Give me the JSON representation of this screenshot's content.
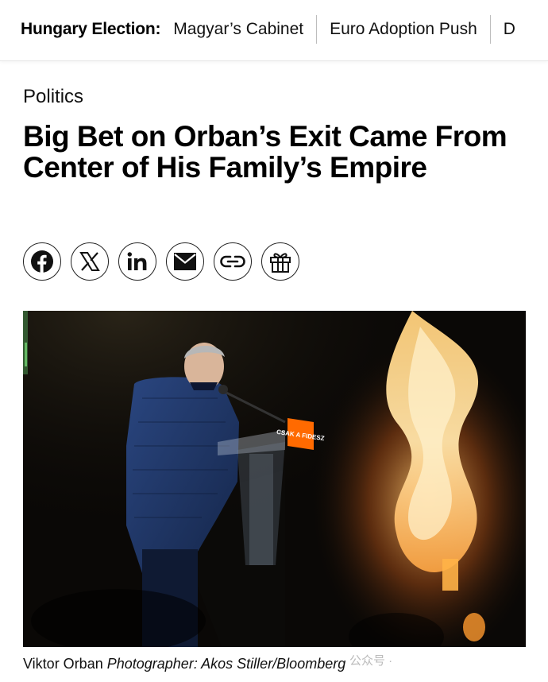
{
  "topbar": {
    "topic_label": "Hungary Election:",
    "links": [
      "Magyar’s Cabinet",
      "Euro Adoption Push",
      "D"
    ]
  },
  "article": {
    "kicker": "Politics",
    "headline": "Big Bet on Orban’s Exit Came From Center of His Family’s Empire"
  },
  "share": {
    "icons": [
      "facebook-icon",
      "x-icon",
      "linkedin-icon",
      "email-icon",
      "link-icon",
      "gift-icon"
    ]
  },
  "photo": {
    "podium_sign": "CSAK A FIDESZ",
    "colors": {
      "background": "#0a0806",
      "flame": "#ffb347",
      "jacket": "#1f3566",
      "sign": "#ff6a00"
    }
  },
  "caption": {
    "subject": "Viktor Orban",
    "credit": "Photographer: Akos Stiller/Bloomberg"
  },
  "watermark": {
    "text": "公众号 ·"
  }
}
